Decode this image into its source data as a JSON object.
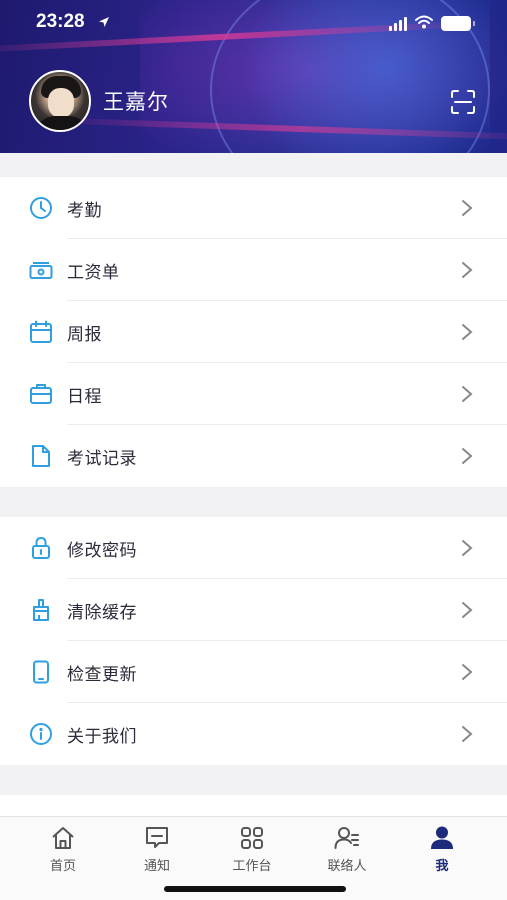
{
  "status_bar": {
    "time": "23:28"
  },
  "profile": {
    "name": "王嘉尔"
  },
  "menu_group_1": [
    {
      "id": "attendance",
      "label": "考勤",
      "icon": "clock-icon"
    },
    {
      "id": "payslip",
      "label": "工资单",
      "icon": "payslip-icon"
    },
    {
      "id": "weekly-report",
      "label": "周报",
      "icon": "calendar-icon"
    },
    {
      "id": "schedule",
      "label": "日程",
      "icon": "briefcase-icon"
    },
    {
      "id": "exam-records",
      "label": "考试记录",
      "icon": "document-icon"
    }
  ],
  "menu_group_2": [
    {
      "id": "change-password",
      "label": "修改密码",
      "icon": "lock-icon"
    },
    {
      "id": "clear-cache",
      "label": "清除缓存",
      "icon": "brush-icon"
    },
    {
      "id": "check-update",
      "label": "检查更新",
      "icon": "phone-icon"
    },
    {
      "id": "about-us",
      "label": "关于我们",
      "icon": "info-icon"
    }
  ],
  "tabbar": [
    {
      "id": "home",
      "label": "首页",
      "icon": "home-icon",
      "active": false
    },
    {
      "id": "notice",
      "label": "通知",
      "icon": "message-icon",
      "active": false
    },
    {
      "id": "workbench",
      "label": "工作台",
      "icon": "grid-icon",
      "active": false
    },
    {
      "id": "contacts",
      "label": "联络人",
      "icon": "contacts-icon",
      "active": false
    },
    {
      "id": "me",
      "label": "我",
      "icon": "person-icon",
      "active": true
    }
  ],
  "colors": {
    "accent_icon": "#2f9fe0",
    "active_tab": "#1e2a7a",
    "inactive_tab": "#555555"
  }
}
